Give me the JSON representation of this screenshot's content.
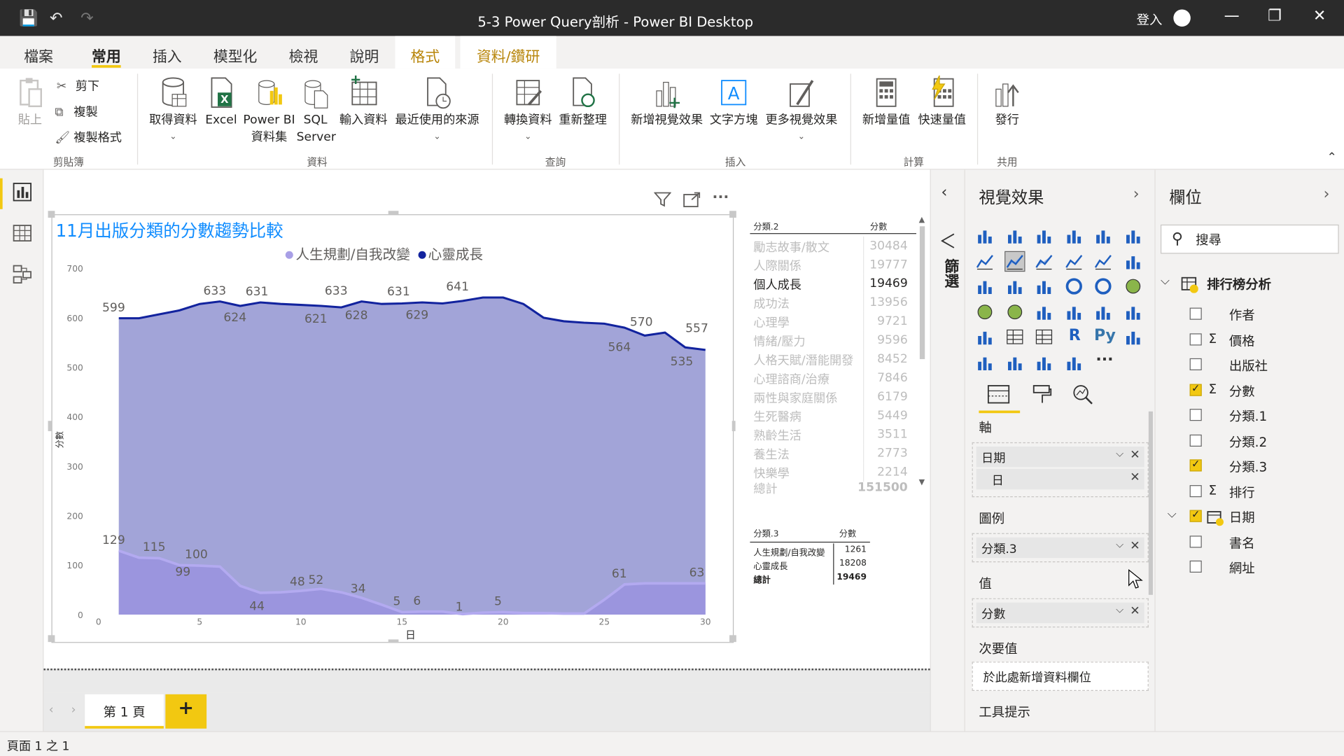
{
  "window": {
    "title": "5-3 Power Query剖析 - Power BI Desktop",
    "sign_in": "登入"
  },
  "tabs": [
    "檔案",
    "常用",
    "插入",
    "模型化",
    "檢視",
    "說明",
    "格式",
    "資料/鑽研"
  ],
  "ribbon": {
    "clipboard": {
      "paste": "貼上",
      "cut": "剪下",
      "copy": "複製",
      "format_painter": "複製格式",
      "group": "剪貼簿"
    },
    "data": {
      "get_data": "取得資料",
      "excel": "Excel",
      "pbi_dataset_1": "Power BI",
      "pbi_dataset_2": "資料集",
      "sql_1": "SQL",
      "sql_2": "Server",
      "enter_data": "輸入資料",
      "recent_sources": "最近使用的來源",
      "group": "資料"
    },
    "queries": {
      "transform": "轉換資料",
      "refresh": "重新整理",
      "group": "查詢"
    },
    "insert": {
      "new_visual": "新增視覺效果",
      "text_box": "文字方塊",
      "more_visuals": "更多視覺效果",
      "group": "插入"
    },
    "calc": {
      "new_measure": "新增量值",
      "quick_measure": "快速量值",
      "group": "計算"
    },
    "share": {
      "publish": "發行",
      "group": "共用"
    }
  },
  "chart_title": "11月出版分類的分數趨勢比較",
  "chart_data": {
    "type": "area",
    "title": "11月出版分類的分數趨勢比較",
    "xlabel": "日",
    "ylabel": "分數",
    "xlim": [
      0,
      30
    ],
    "ylim": [
      0,
      700
    ],
    "xticks": [
      0,
      5,
      10,
      15,
      20,
      25,
      30
    ],
    "yticks": [
      0,
      100,
      200,
      300,
      400,
      500,
      600,
      700
    ],
    "legend_position": "top",
    "series": [
      {
        "name": "人生規劃/自我改變",
        "color": "#a89fe6",
        "x": [
          1,
          2,
          3,
          4,
          5,
          6,
          7,
          8,
          9,
          10,
          11,
          12,
          13,
          14,
          15,
          16,
          17,
          18,
          19,
          20,
          21,
          22,
          23,
          24,
          25,
          26,
          27,
          28,
          29,
          30
        ],
        "y": [
          129,
          115,
          114,
          100,
          99,
          97,
          58,
          44,
          45,
          48,
          52,
          45,
          34,
          20,
          5,
          6,
          6,
          1,
          4,
          5,
          3,
          3,
          2,
          2,
          30,
          61,
          63,
          63,
          63,
          63
        ]
      },
      {
        "name": "心靈成長",
        "color": "#12239e",
        "x": [
          1,
          2,
          3,
          4,
          5,
          6,
          7,
          8,
          9,
          10,
          11,
          12,
          13,
          14,
          15,
          16,
          17,
          18,
          19,
          20,
          21,
          22,
          23,
          24,
          25,
          26,
          27,
          28,
          29,
          30
        ],
        "y": [
          599,
          599,
          607,
          615,
          628,
          633,
          624,
          631,
          628,
          626,
          624,
          621,
          633,
          628,
          629,
          631,
          629,
          634,
          641,
          641,
          628,
          600,
          593,
          590,
          588,
          580,
          564,
          570,
          540,
          535
        ]
      }
    ],
    "data_labels": [
      {
        "x": 1,
        "y": 599,
        "text": "599"
      },
      {
        "x": 6,
        "y": 633,
        "text": "633"
      },
      {
        "x": 7,
        "y": 624,
        "text": "624"
      },
      {
        "x": 8,
        "y": 631,
        "text": "631"
      },
      {
        "x": 11,
        "y": 621,
        "text": "621"
      },
      {
        "x": 12,
        "y": 633,
        "text": "633"
      },
      {
        "x": 13,
        "y": 628,
        "text": "628"
      },
      {
        "x": 15,
        "y": 631,
        "text": "631"
      },
      {
        "x": 16,
        "y": 629,
        "text": "629"
      },
      {
        "x": 18,
        "y": 641,
        "text": "641"
      },
      {
        "x": 26,
        "y": 564,
        "text": "564"
      },
      {
        "x": 27,
        "y": 570,
        "text": "570"
      },
      {
        "x": 29,
        "y": 535,
        "text": "535"
      },
      {
        "x": 30,
        "y": 557,
        "text": "557"
      },
      {
        "x": 1,
        "y": 129,
        "text": "129"
      },
      {
        "x": 3,
        "y": 115,
        "text": "115"
      },
      {
        "x": 4,
        "y": 99,
        "text": "99"
      },
      {
        "x": 5,
        "y": 100,
        "text": "100"
      },
      {
        "x": 8,
        "y": 44,
        "text": "44"
      },
      {
        "x": 10,
        "y": 48,
        "text": "48"
      },
      {
        "x": 11,
        "y": 52,
        "text": "52"
      },
      {
        "x": 13,
        "y": 34,
        "text": "34"
      },
      {
        "x": 15,
        "y": 5,
        "text": "5"
      },
      {
        "x": 16,
        "y": 6,
        "text": "6"
      },
      {
        "x": 18,
        "y": 1,
        "text": "1"
      },
      {
        "x": 20,
        "y": 5,
        "text": "5"
      },
      {
        "x": 26,
        "y": 61,
        "text": "61"
      },
      {
        "x": 30,
        "y": 63,
        "text": "63"
      }
    ]
  },
  "table1": {
    "headers": [
      "分類.2",
      "分數"
    ],
    "rows": [
      [
        "勵志故事/散文",
        "30484"
      ],
      [
        "人際關係",
        "19777"
      ],
      [
        "個人成長",
        "19469"
      ],
      [
        "成功法",
        "13956"
      ],
      [
        "心理學",
        "9721"
      ],
      [
        "情緒/壓力",
        "9596"
      ],
      [
        "人格天賦/潛能開發",
        "8452"
      ],
      [
        "心理諮商/治療",
        "7846"
      ],
      [
        "兩性與家庭關係",
        "6179"
      ],
      [
        "生死醫病",
        "5449"
      ],
      [
        "熟齡生活",
        "3511"
      ],
      [
        "養生法",
        "2773"
      ],
      [
        "快樂學",
        "2214"
      ]
    ],
    "total_label": "總計",
    "total": "151500"
  },
  "table2": {
    "headers": [
      "分類.3",
      "分數"
    ],
    "rows": [
      [
        "人生規劃/自我改變",
        "1261"
      ],
      [
        "心靈成長",
        "18208"
      ]
    ],
    "total_label": "總計",
    "total": "19469"
  },
  "page_tab": "第 1 頁",
  "status": "頁面 1 之 1",
  "filters_label": "篩選",
  "vis_pane": {
    "title": "視覺效果",
    "axis": "軸",
    "axis_fields": [
      "日期",
      "日"
    ],
    "legend": "圖例",
    "legend_field": "分類.3",
    "values": "值",
    "values_field": "分數",
    "secondary": "次要值",
    "secondary_placeholder": "於此處新增資料欄位",
    "tooltips": "工具提示",
    "r_icon": "R",
    "py_icon": "Py",
    "more": "···"
  },
  "fields_pane": {
    "title": "欄位",
    "search_placeholder": "搜尋",
    "table_name": "排行榜分析",
    "fields": [
      {
        "name": "作者",
        "checked": false,
        "sigma": false
      },
      {
        "name": "價格",
        "checked": false,
        "sigma": true
      },
      {
        "name": "出版社",
        "checked": false,
        "sigma": false
      },
      {
        "name": "分數",
        "checked": true,
        "sigma": true
      },
      {
        "name": "分類.1",
        "checked": false,
        "sigma": false
      },
      {
        "name": "分類.2",
        "checked": false,
        "sigma": false
      },
      {
        "name": "分類.3",
        "checked": true,
        "sigma": false
      },
      {
        "name": "排行",
        "checked": false,
        "sigma": true
      }
    ],
    "date_field": "日期",
    "date_children": [
      {
        "name": "書名",
        "checked": false
      },
      {
        "name": "網址",
        "checked": false
      }
    ]
  },
  "colors": {
    "accent": "#f2c811",
    "title_blue": "#118dff",
    "series1": "#a89fe6",
    "series2": "#12239e"
  }
}
